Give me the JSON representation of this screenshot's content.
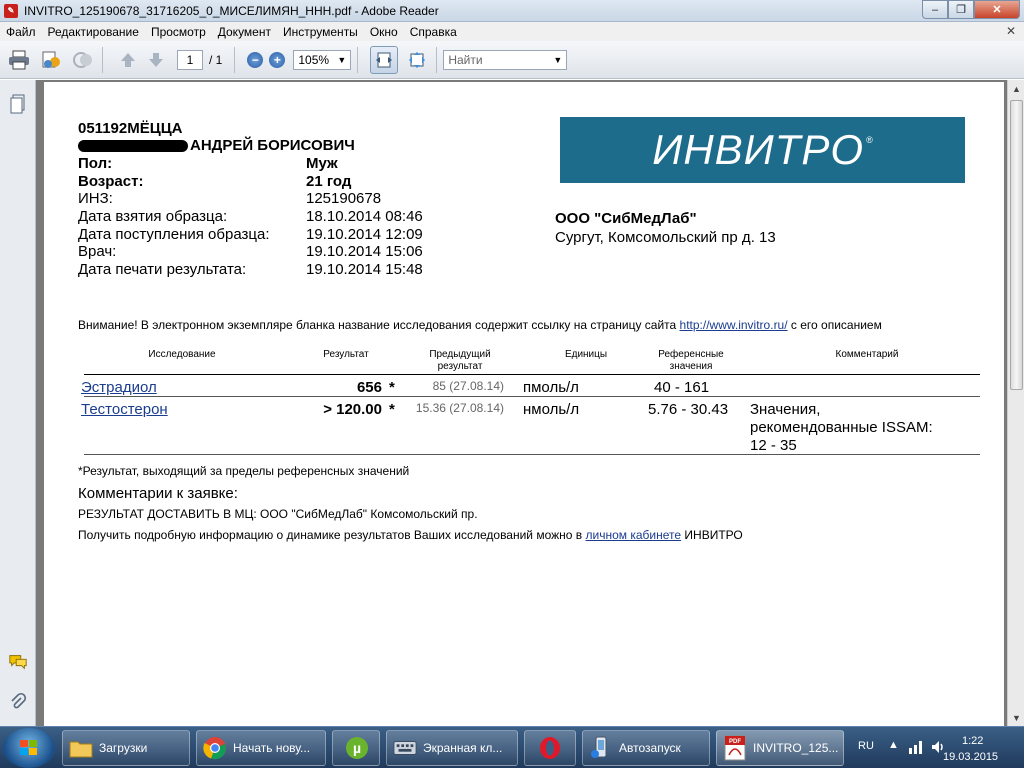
{
  "window": {
    "title": "INVITRO_125190678_31716205_0_МИСЕЛИМЯН_ННН.pdf - Adobe Reader",
    "app_icon": "pdf-icon",
    "min_label": "–",
    "max_label": "❐",
    "close_label": "✕"
  },
  "menu": {
    "items": [
      "Файл",
      "Редактирование",
      "Просмотр",
      "Документ",
      "Инструменты",
      "Окно",
      "Справка"
    ],
    "close_label": "✕"
  },
  "toolbar": {
    "page_current": "1",
    "page_total": "/ 1",
    "zoom": "105%",
    "find_placeholder": "Найти"
  },
  "document": {
    "patient_id": "051192МЁЦЦА",
    "patient_name": "АНДРЕЙ БОРИСОВИЧ",
    "fields": [
      {
        "label": "Пол:",
        "value": "Муж"
      },
      {
        "label": "Возраст:",
        "value": "21 год"
      },
      {
        "label": "ИНЗ:",
        "value": "125190678"
      },
      {
        "label": "Дата взятия образца:",
        "value": "18.10.2014 08:46"
      },
      {
        "label": "Дата поступления образца:",
        "value": "19.10.2014 12:09"
      },
      {
        "label": "Врач:",
        "value": "19.10.2014 15:06"
      },
      {
        "label": "Дата печати результата:",
        "value": "19.10.2014 15:48"
      }
    ],
    "logo_text": "ИНВИТРО",
    "logo_reg": "®",
    "lab_name": "ООО \"СибМедЛаб\"",
    "lab_address": "Сургут, Комсомольский пр д. 13",
    "notice_prefix": "Внимание! В электронном экземпляре бланка название исследования содержит ссылку на страницу сайта ",
    "notice_link": "http://www.invitro.ru/",
    "notice_suffix": " с его описанием",
    "table": {
      "headers": {
        "test": "Исследование",
        "result": "Результат",
        "previous": "Предыдущий результат",
        "units": "Единицы",
        "reference": "Референсные значения",
        "comment": "Комментарий"
      },
      "rows": [
        {
          "test": "Эстрадиол",
          "result": "656",
          "flag": "*",
          "previous": "85 (27.08.14)",
          "units": "пмоль/л",
          "reference": "40 - 161",
          "comment": ""
        },
        {
          "test": "Тестостерон",
          "result": "> 120.00",
          "flag": "*",
          "previous": "15.36 (27.08.14)",
          "units": "нмоль/л",
          "reference": "5.76 - 30.43",
          "comment_lines": [
            "Значения,",
            "рекомендованные ISSAM:",
            "12 - 35"
          ]
        }
      ]
    },
    "footnote": "*Результат, выходящий за пределы референсных значений",
    "comments_title": "Комментарии к заявке:",
    "comments_text": "РЕЗУЛЬТАТ ДОСТАВИТЬ В МЦ: ООО \"СибМедЛаб\" Комсомольский пр.",
    "info_prefix": "Получить подробную информацию о динамике результатов Ваших исследований можно в ",
    "info_link": "личном кабинете",
    "info_suffix": " ИНВИТРО"
  },
  "taskbar": {
    "items": [
      {
        "label": "Загрузки",
        "icon": "folder-icon"
      },
      {
        "label": "Начать нову...",
        "icon": "chrome-icon"
      },
      {
        "label": "",
        "icon": "utorrent-icon"
      },
      {
        "label": "Экранная кл...",
        "icon": "keyboard-icon"
      },
      {
        "label": "",
        "icon": "opera-icon"
      },
      {
        "label": "Автозапуск",
        "icon": "autorun-icon"
      },
      {
        "label": "INVITRO_125...",
        "icon": "adobe-pdf-icon"
      }
    ],
    "lang": "RU",
    "time": "1:22",
    "date": "19.03.2015"
  }
}
